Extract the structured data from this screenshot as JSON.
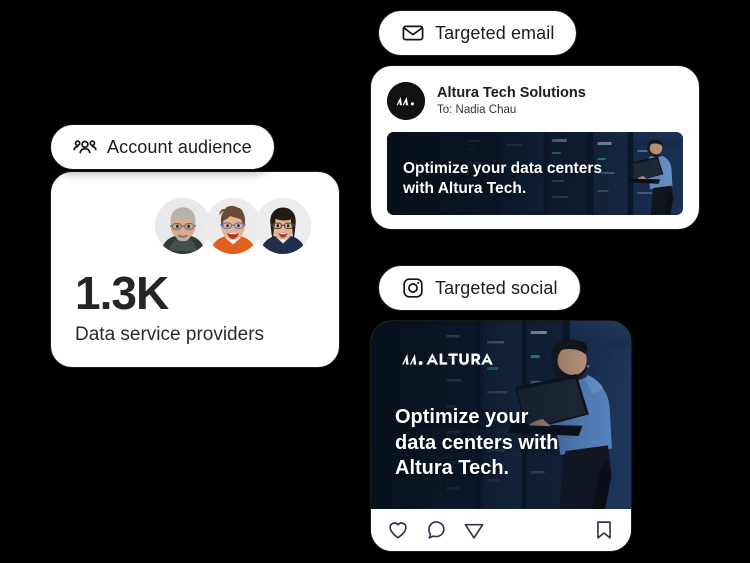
{
  "background_color": "#000000",
  "cards": {
    "audience": {
      "pill": {
        "label": "Account audience",
        "icon": "people-group-icon"
      },
      "metric_value": "1.3K",
      "metric_label": "Data service providers",
      "avatar_count": 3,
      "avatars": [
        {
          "name": "avatar-person-1"
        },
        {
          "name": "avatar-person-2"
        },
        {
          "name": "avatar-person-3"
        }
      ]
    },
    "email": {
      "pill": {
        "label": "Targeted email",
        "icon": "envelope-icon"
      },
      "sender": "Altura Tech Solutions",
      "recipient": "To: Nadia Chau",
      "logo_alt": "altura-logo-icon",
      "banner_headline_line1": "Optimize your data centers",
      "banner_headline_line2": "with Altura Tech.",
      "banner_bg_color": "#0b1525"
    },
    "social": {
      "pill": {
        "label": "Targeted social",
        "icon": "instagram-camera-icon"
      },
      "logo_wordmark": "ALTURA",
      "headline_line1": "Optimize your",
      "headline_line2": "data centers with",
      "headline_line3": "Altura Tech.",
      "image_bg_color": "#0a1422",
      "actions": [
        {
          "name": "like-heart-icon"
        },
        {
          "name": "comment-bubble-icon"
        },
        {
          "name": "share-send-icon"
        },
        {
          "name": "bookmark-save-icon"
        }
      ]
    }
  },
  "colors": {
    "card_border": "#1a1a1a",
    "card_bg": "#ffffff",
    "text_dark": "#1c1c1c",
    "navy": "#16253c",
    "social_icon": "#2b3550"
  }
}
